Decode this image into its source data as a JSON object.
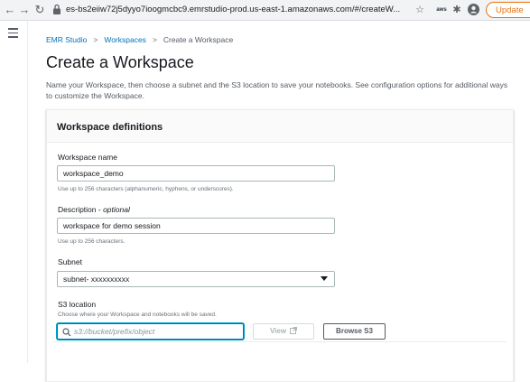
{
  "browser": {
    "back_icon": "←",
    "forward_icon": "→",
    "reload_icon": "↻",
    "url": "es-bs2eiiw72j5dyyo7ioogmcbc9.emrstudio-prod.us-east-1.amazonaws.com/#/createW...",
    "star_icon": "☆",
    "ext_label": "aws",
    "puzzle_icon": "✱",
    "update_label": "Update"
  },
  "breadcrumb": {
    "items": [
      "EMR Studio",
      "Workspaces",
      "Create a Workspace"
    ],
    "separator": ">"
  },
  "page": {
    "title": "Create a Workspace",
    "description": "Name your Workspace, then choose a subnet and the S3 location to save your notebooks. See configuration options for additional ways to customize the Workspace."
  },
  "form": {
    "section_title": "Workspace definitions",
    "name_label": "Workspace name",
    "name_value": "workspace_demo",
    "name_hint": "Use up to 256 characters (alphanumeric, hyphens, or underscores).",
    "description_label": "Description - ",
    "description_optional": "optional",
    "description_value": "workspace for demo session",
    "description_hint": "Use up to 256 characters.",
    "subnet_label": "Subnet",
    "subnet_value": "subnet- xxxxxxxxxx",
    "s3_label": "S3 location",
    "s3_hint": "Choose where your Workspace and notebooks will be saved.",
    "s3_placeholder": "s3://bucket/prefix/object",
    "view_button": "View",
    "browse_button": "Browse S3"
  },
  "colors": {
    "link": "#0073bb",
    "update_accent": "#e8710a",
    "focus": "#00a1c9"
  }
}
